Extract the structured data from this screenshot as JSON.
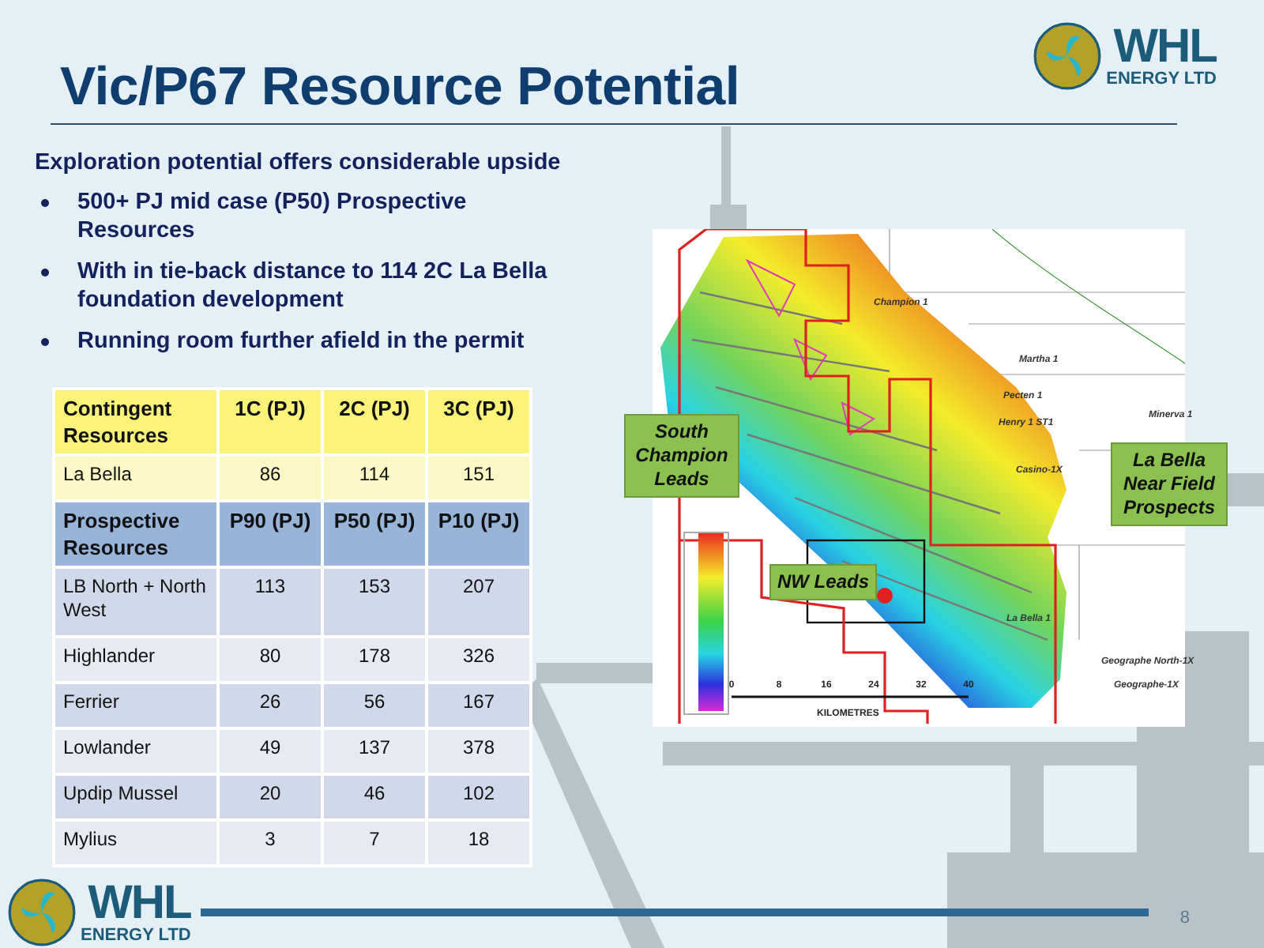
{
  "title": "Vic/P67 Resource Potential",
  "logo": {
    "name": "WHL",
    "subtitle": "ENERGY LTD"
  },
  "intro": "Exploration potential offers considerable upside",
  "bullets": [
    "500+ PJ mid case (P50) Prospective Resources",
    "With in tie-back distance to 114 2C La Bella foundation development",
    "Running room further afield in the permit"
  ],
  "table": {
    "sections": [
      {
        "kind": "contingent",
        "columns": [
          "Contingent Resources",
          "1C (PJ)",
          "2C (PJ)",
          "3C (PJ)"
        ],
        "rows": [
          [
            "La Bella",
            "86",
            "114",
            "151"
          ]
        ]
      },
      {
        "kind": "prospective",
        "columns": [
          "Prospective Resources",
          "P90 (PJ)",
          "P50 (PJ)",
          "P10 (PJ)"
        ],
        "rows": [
          [
            "LB North + North West",
            "113",
            "153",
            "207"
          ],
          [
            "Highlander",
            "80",
            "178",
            "326"
          ],
          [
            "Ferrier",
            "26",
            "56",
            "167"
          ],
          [
            "Lowlander",
            "49",
            "137",
            "378"
          ],
          [
            "Updip Mussel",
            "20",
            "46",
            "102"
          ],
          [
            "Mylius",
            "3",
            "7",
            "18"
          ]
        ]
      }
    ]
  },
  "map": {
    "wells": [
      "Champion 1",
      "Martha 1",
      "Pecten 1",
      "Henry 1 ST1",
      "Minerva 1",
      "Casino-1X",
      "La Bella 1",
      "Geographe North-1X",
      "Geographe-1X"
    ],
    "callouts": [
      "South Champion Leads",
      "NW Leads",
      "La Bella Near Field Prospects"
    ],
    "scale": {
      "ticks": [
        "0",
        "8",
        "16",
        "24",
        "32",
        "40"
      ],
      "label": "KILOMETRES"
    }
  },
  "footer": {
    "logo": {
      "name": "WHL",
      "subtitle": "ENERGY LTD"
    },
    "page": "8"
  }
}
